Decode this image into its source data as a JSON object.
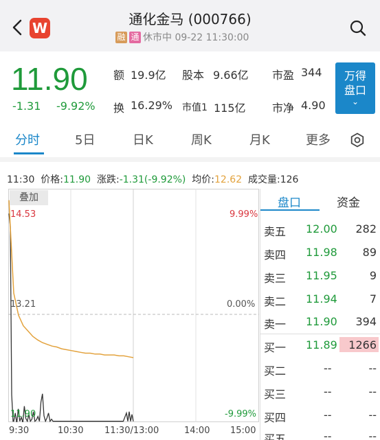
{
  "header": {
    "title": "通化金马 (000766)",
    "logo_text": "W",
    "tag_rong": "融",
    "tag_tong": "通",
    "status": "休市中 09-22 11:30:00",
    "back_icon": "chevron-left-icon",
    "search_icon": "search-icon"
  },
  "quote": {
    "price": "11.90",
    "change": "-1.31",
    "change_pct": "-9.92%",
    "stats": {
      "amount_label": "额",
      "amount": "19.9亿",
      "capital_label": "股本",
      "capital": "9.66亿",
      "pe_label": "市盈",
      "pe": "344",
      "turnover_label": "换",
      "turnover": "16.29%",
      "mktcap_label": "市值1",
      "mktcap": "115亿",
      "pb_label": "市净",
      "pb": "4.90"
    },
    "wande_line1": "万得",
    "wande_line2": "盘口",
    "wande_chevron": "⌄"
  },
  "tabs": {
    "items": [
      "分时",
      "5日",
      "日K",
      "周K",
      "月K",
      "更多"
    ],
    "active": "分时",
    "settings_icon": "settings-icon"
  },
  "info": {
    "time": "11:30",
    "price_label": "价格:",
    "price": "11.90",
    "chg_label": "涨跌:",
    "chg": "-1.31(-9.92%)",
    "avg_label": "均价:",
    "avg": "12.62",
    "vol_label": "成交量:",
    "vol": "126"
  },
  "chart": {
    "overlay_label": "叠加",
    "top_left": "14.53",
    "mid_left": "13.21",
    "bottom_left": "11.90",
    "top_right": "9.99%",
    "mid_right": "0.00%",
    "bottom_right": "-9.99%",
    "time_labels": [
      "9:30",
      "10:30",
      "11:30/13:00",
      "14:00",
      "15:00"
    ]
  },
  "chart_data": {
    "type": "line",
    "ylim": [
      11.89,
      14.53
    ],
    "series": [
      {
        "values": [
          14.4,
          13.35,
          13.1,
          12.98,
          12.92,
          12.86,
          12.82,
          12.79,
          12.77,
          12.75,
          12.74,
          12.72,
          12.71,
          12.7,
          12.69,
          12.68,
          12.67,
          12.67,
          12.66,
          12.66,
          12.65,
          12.65,
          12.65,
          12.64,
          12.64,
          12.63,
          12.62
        ]
      }
    ]
  },
  "orderbook": {
    "tab_active": "盘口",
    "tab_other": "资金",
    "sell": [
      {
        "label": "卖五",
        "price": "12.00",
        "vol": "282"
      },
      {
        "label": "卖四",
        "price": "11.98",
        "vol": "89"
      },
      {
        "label": "卖三",
        "price": "11.95",
        "vol": "9"
      },
      {
        "label": "卖二",
        "price": "11.94",
        "vol": "7"
      },
      {
        "label": "卖一",
        "price": "11.90",
        "vol": "394"
      }
    ],
    "buy": [
      {
        "label": "买一",
        "price": "11.89",
        "vol": "1266"
      },
      {
        "label": "买二",
        "price": "--",
        "vol": "--"
      },
      {
        "label": "买三",
        "price": "--",
        "vol": "--"
      },
      {
        "label": "买四",
        "price": "--",
        "vol": "--"
      },
      {
        "label": "买五",
        "price": "--",
        "vol": "--"
      }
    ]
  },
  "colors": {
    "green": "#1f9a3a",
    "red": "#d9363e",
    "blue": "#1b87c9",
    "avg_line": "#e3a23c"
  }
}
